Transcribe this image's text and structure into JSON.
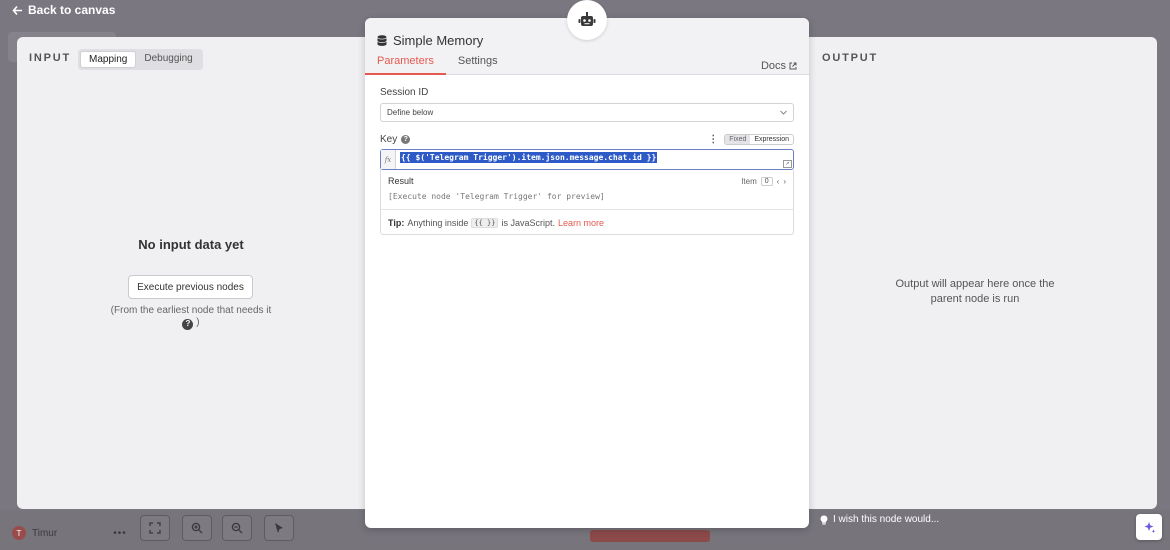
{
  "top_bar": {
    "back_label": "Back to canvas"
  },
  "input_panel": {
    "label": "INPUT",
    "tabs": [
      {
        "label": "Mapping",
        "active": true
      },
      {
        "label": "Debugging",
        "active": false
      }
    ],
    "empty_title": "No input data yet",
    "execute_button": "Execute previous nodes",
    "hint_before": "(From the earliest node that needs it",
    "hint_after": ")"
  },
  "node": {
    "title": "Simple Memory",
    "tabs": [
      {
        "label": "Parameters",
        "active": true
      },
      {
        "label": "Settings",
        "active": false
      }
    ],
    "docs_label": "Docs",
    "session_id": {
      "label": "Session ID",
      "value": "Define below"
    },
    "key": {
      "label": "Key",
      "mode_fixed": "Fixed",
      "mode_expression": "Expression",
      "fx_label": "fx",
      "expression": "{{ $('Telegram Trigger').item.json.message.chat.id }}"
    },
    "result": {
      "label": "Result",
      "item_label": "Item",
      "item_index": "0",
      "preview": "[Execute node 'Telegram Trigger' for preview]"
    },
    "tip": {
      "label": "Tip:",
      "before": "Anything inside",
      "code": "{{ }}",
      "after": "is JavaScript.",
      "link": "Learn more"
    }
  },
  "output_panel": {
    "label": "OUTPUT",
    "empty_text": "Output will appear here once the parent node is run"
  },
  "footer": {
    "feedback": "I wish this node would...",
    "user_name": "Timur",
    "user_initial": "T"
  },
  "colors": {
    "accent": "#e55a4e",
    "selection": "#2d5ac6",
    "focus_border": "#6b7fc4"
  },
  "icons": [
    "arrow-left-icon",
    "robot-icon",
    "database-icon",
    "external-link-icon",
    "chevron-down-icon",
    "help-icon",
    "more-vertical-icon",
    "expand-icon",
    "chevron-left-icon",
    "chevron-right-icon",
    "lightbulb-icon",
    "sparkle-icon",
    "fit-view-icon",
    "zoom-in-icon",
    "zoom-out-icon",
    "pointer-icon"
  ]
}
